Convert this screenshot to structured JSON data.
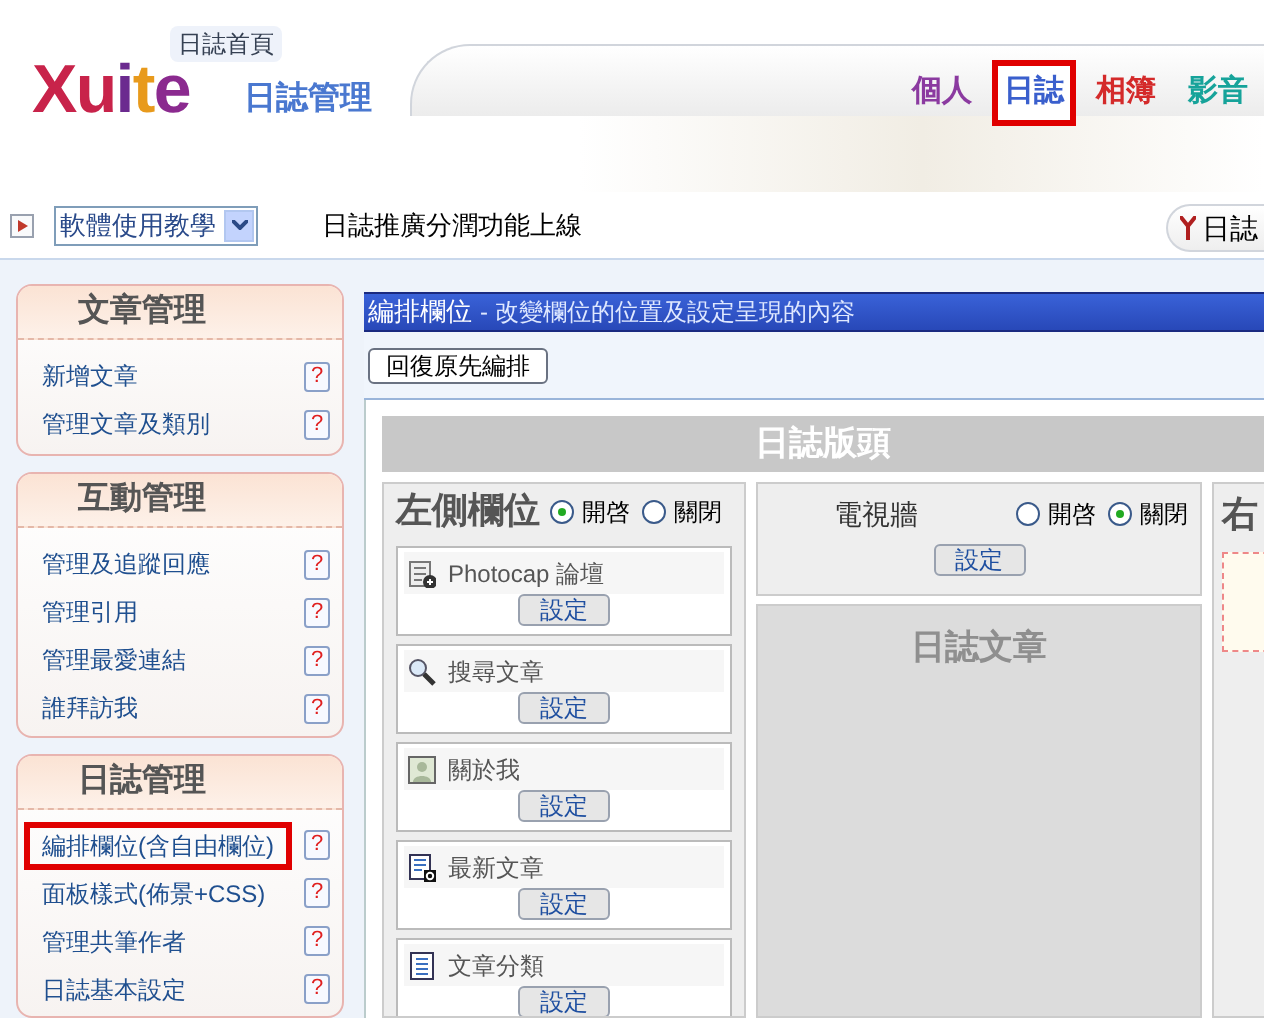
{
  "header": {
    "logo": {
      "text": "Xuite",
      "badge": "日誌首頁",
      "subtitle": "日誌管理"
    },
    "nav": [
      {
        "label": "個人",
        "color": "#8b3aa0",
        "selected": false
      },
      {
        "label": "日誌",
        "color": "#3a5fcd",
        "selected": true
      },
      {
        "label": "相簿",
        "color": "#d42a2a",
        "selected": false
      },
      {
        "label": "影音",
        "color": "#16a39a",
        "selected": false
      }
    ]
  },
  "toolbar": {
    "select": {
      "value": "軟體使用教學"
    },
    "announcement": "日誌推廣分潤功能上線",
    "blog_button": "日誌"
  },
  "sidebar": [
    {
      "title": "文章管理",
      "items": [
        {
          "label": "新增文章",
          "help": "?",
          "selected": false
        },
        {
          "label": "管理文章及類別",
          "help": "?",
          "selected": false
        }
      ]
    },
    {
      "title": "互動管理",
      "items": [
        {
          "label": "管理及追蹤回應",
          "help": "?",
          "selected": false
        },
        {
          "label": "管理引用",
          "help": "?",
          "selected": false
        },
        {
          "label": "管理最愛連結",
          "help": "?",
          "selected": false
        },
        {
          "label": "誰拜訪我",
          "help": "?",
          "selected": false
        }
      ]
    },
    {
      "title": "日誌管理",
      "items": [
        {
          "label": "編排欄位(含自由欄位)",
          "help": "?",
          "selected": true
        },
        {
          "label": "面板樣式(佈景+CSS)",
          "help": "?",
          "selected": false
        },
        {
          "label": "管理共筆作者",
          "help": "?",
          "selected": false
        },
        {
          "label": "日誌基本設定",
          "help": "?",
          "selected": false
        }
      ]
    }
  ],
  "main": {
    "title": "編排欄位",
    "subtitle": "- 改變欄位的位置及設定呈現的內容",
    "restore_button": "回復原先編排",
    "header_zone": "日誌版頭",
    "left_column": {
      "title": "左側欄位",
      "options": [
        {
          "label": "開啓",
          "selected": true
        },
        {
          "label": "關閉",
          "selected": false
        }
      ],
      "widgets": [
        {
          "kind": "forum",
          "label": "Photocap 論壇",
          "button": "設定"
        },
        {
          "kind": "search",
          "label": "搜尋文章",
          "button": "設定"
        },
        {
          "kind": "profile",
          "label": "關於我",
          "button": "設定"
        },
        {
          "kind": "recent",
          "label": "最新文章",
          "button": "設定"
        },
        {
          "kind": "category",
          "label": "文章分類",
          "button": "設定"
        }
      ]
    },
    "tv_wall": {
      "title": "電視牆",
      "options": [
        {
          "label": "開啓",
          "selected": false
        },
        {
          "label": "關閉",
          "selected": true
        }
      ],
      "button": "設定"
    },
    "articles_zone": "日誌文章",
    "right_column": {
      "title": "右"
    }
  }
}
